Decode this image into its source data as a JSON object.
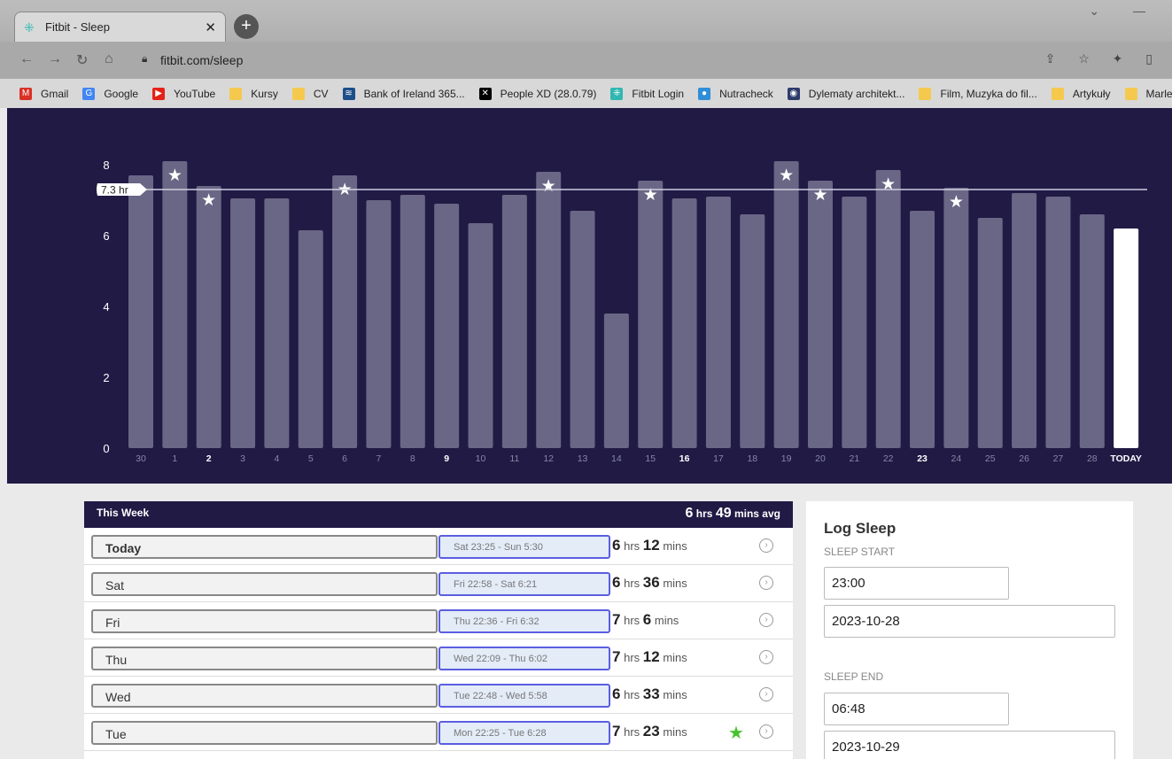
{
  "browser": {
    "tab_title": "Fitbit - Sleep",
    "url": "fitbit.com/sleep",
    "bookmarks": [
      {
        "label": "Gmail",
        "icon": "gmail-icon",
        "color": "#d93025",
        "glyph": "M"
      },
      {
        "label": "Google",
        "icon": "google-icon",
        "color": "#4285f4",
        "glyph": "G"
      },
      {
        "label": "YouTube",
        "icon": "youtube-icon",
        "color": "#e62117",
        "glyph": "▶"
      },
      {
        "label": "Kursy",
        "icon": "folder-icon",
        "color": "#f4c94d",
        "glyph": ""
      },
      {
        "label": "CV",
        "icon": "folder-icon",
        "color": "#f4c94d",
        "glyph": ""
      },
      {
        "label": "Bank of Ireland 365...",
        "icon": "bank-icon",
        "color": "#1d4f8a",
        "glyph": "≋"
      },
      {
        "label": "People XD (28.0.79)",
        "icon": "x-icon",
        "color": "#000000",
        "glyph": "✕"
      },
      {
        "label": "Fitbit Login",
        "icon": "fitbit-icon",
        "color": "#2fb7b0",
        "glyph": "⁜"
      },
      {
        "label": "Nutracheck",
        "icon": "globe-icon",
        "color": "#2e8ed8",
        "glyph": "●"
      },
      {
        "label": "Dylematy architekt...",
        "icon": "site-icon",
        "color": "#2d3a6a",
        "glyph": "◉"
      },
      {
        "label": "Film, Muzyka do fil...",
        "icon": "folder-icon",
        "color": "#f4c94d",
        "glyph": ""
      },
      {
        "label": "Artykuły",
        "icon": "folder-icon",
        "color": "#f4c94d",
        "glyph": ""
      },
      {
        "label": "Marlena",
        "icon": "folder-icon",
        "color": "#f4c94d",
        "glyph": ""
      }
    ]
  },
  "chart_data": {
    "type": "bar",
    "categories": [
      "30",
      "1",
      "2",
      "3",
      "4",
      "5",
      "6",
      "7",
      "8",
      "9",
      "10",
      "11",
      "12",
      "13",
      "14",
      "15",
      "16",
      "17",
      "18",
      "19",
      "20",
      "21",
      "22",
      "23",
      "24",
      "25",
      "26",
      "27",
      "28",
      "TODAY"
    ],
    "bold_categories": [
      "2",
      "9",
      "16",
      "23",
      "TODAY"
    ],
    "values": [
      7.7,
      8.1,
      7.4,
      7.05,
      7.05,
      6.15,
      7.7,
      7.0,
      7.15,
      6.9,
      6.35,
      7.15,
      7.8,
      6.7,
      3.8,
      7.55,
      7.05,
      7.1,
      6.6,
      8.1,
      7.55,
      7.1,
      7.85,
      6.7,
      7.35,
      6.5,
      7.2,
      7.1,
      6.6,
      6.2
    ],
    "star_days": [
      "1",
      "2",
      "6",
      "12",
      "15",
      "19",
      "20",
      "22",
      "24"
    ],
    "average_label": "7.3 hr",
    "average": 7.3,
    "ylim": [
      0,
      8
    ],
    "yticks": [
      "0",
      "2",
      "4",
      "6",
      "8"
    ],
    "colors": {
      "bar": "#6a6685",
      "today_bar": "#ffffff",
      "background": "#201a45",
      "line": "#cfcde0"
    }
  },
  "week": {
    "title": "This Week",
    "avg_hrs": "6",
    "avg_mins": "49",
    "hrs_unit": "hrs",
    "mins_unit": "mins avg",
    "rows": [
      {
        "day": "Today",
        "range": "Sat 23:25 - Sun 5:30",
        "hrs": "6",
        "mins": "12",
        "star": false
      },
      {
        "day": "Sat",
        "range": "Fri 22:58 - Sat 6:21",
        "hrs": "6",
        "mins": "36",
        "star": false
      },
      {
        "day": "Fri",
        "range": "Thu 22:36 - Fri 6:32",
        "hrs": "7",
        "mins": "6",
        "star": false
      },
      {
        "day": "Thu",
        "range": "Wed 22:09 - Thu 6:02",
        "hrs": "7",
        "mins": "12",
        "star": false
      },
      {
        "day": "Wed",
        "range": "Tue 22:48 - Wed 5:58",
        "hrs": "6",
        "mins": "33",
        "star": false
      },
      {
        "day": "Tue",
        "range": "Mon 22:25 - Tue 6:28",
        "hrs": "7",
        "mins": "23",
        "star": true
      }
    ]
  },
  "log": {
    "title": "Log Sleep",
    "start_label": "SLEEP START",
    "start_time": "23:00",
    "start_date": "2023-10-28",
    "end_label": "SLEEP END",
    "end_time": "06:48",
    "end_date": "2023-10-29"
  }
}
